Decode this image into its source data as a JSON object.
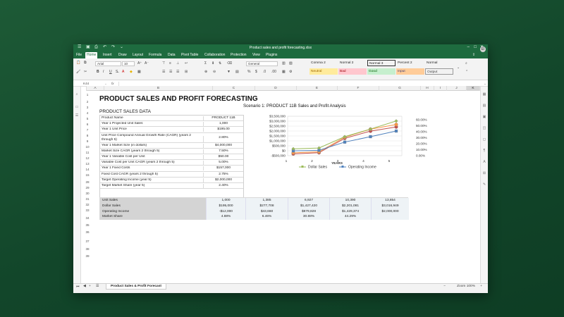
{
  "window": {
    "title": "Product sales and profit forecasting.xlsx",
    "avatar": "EI"
  },
  "menu_tabs": [
    "File",
    "Home",
    "Insert",
    "Draw",
    "Layout",
    "Formula",
    "Data",
    "Pivot Table",
    "Collaboration",
    "Protection",
    "View",
    "Plugins"
  ],
  "ribbon": {
    "font_name": "Arial",
    "font_size": "10",
    "number_format": "General",
    "styles": [
      {
        "label": "Comma 2",
        "bg": "#ffffff",
        "color": "#222222"
      },
      {
        "label": "Normal 2",
        "bg": "#ffffff",
        "color": "#222222"
      },
      {
        "label": "Normal 3",
        "bg": "#ffffff",
        "color": "#222222"
      },
      {
        "label": "Percent 2",
        "bg": "#ffffff",
        "color": "#222222"
      },
      {
        "label": "Normal",
        "bg": "#ffffff",
        "color": "#222222"
      },
      {
        "label": "Neutral",
        "bg": "#ffeb9c",
        "color": "#9c6500"
      },
      {
        "label": "Bad",
        "bg": "#ffc7ce",
        "color": "#9c0006"
      },
      {
        "label": "Good",
        "bg": "#c6efce",
        "color": "#006100"
      },
      {
        "label": "Input",
        "bg": "#ffcc99",
        "color": "#3f3f76"
      },
      {
        "label": "Output",
        "bg": "#f2f2f2",
        "color": "#3f3f3f"
      }
    ]
  },
  "formula_bar": {
    "name_box": "K44",
    "fx": "fx"
  },
  "columns": [
    "A",
    "B",
    "C",
    "D",
    "E",
    "F",
    "G",
    "H",
    "I",
    "J",
    "K"
  ],
  "rows": [
    "1",
    "2",
    "3",
    "4",
    "5",
    "6",
    "7",
    "8",
    "9",
    "10",
    "11",
    "12",
    "13",
    "14",
    "15",
    "28",
    "29",
    "30",
    "31",
    "32",
    "33",
    "34",
    "35",
    "36",
    "37",
    "38",
    "39"
  ],
  "sheet": {
    "title": "PRODUCT SALES AND PROFIT FORECASTING",
    "section_title": "PRODUCT SALES DATA",
    "inputs": [
      {
        "label": "Product Name",
        "value": "PRODUCT 11B"
      },
      {
        "label": "Year 1 Projected Unit Sales",
        "value": "1,000"
      },
      {
        "label": "Year 1 Unit Price",
        "value": "$195.00"
      },
      {
        "label": "Unit Price Compound Annual Growth Rate (CAGR) (years 2 through 5)",
        "value": "2.80%"
      },
      {
        "label": "Year 1 Market Size (in dollars)",
        "value": "$4,000,000"
      },
      {
        "label": "Market Size CAGR (years 2 through 5)",
        "value": "7.50%"
      },
      {
        "label": "Year 1 Variable Cost per Unit",
        "value": "$50.00"
      },
      {
        "label": "Variable Cost per Unit CAGR (years 2 through 5)",
        "value": "5.00%"
      },
      {
        "label": "Year 1 Fixed Costs",
        "value": "$157,000"
      },
      {
        "label": "Fixed Cost CAGR (years 2 through 5)",
        "value": "2.75%"
      },
      {
        "label": "Target Operating Income (year 5)",
        "value": "$2,000,000"
      },
      {
        "label": "Target Market Share (year 5)",
        "value": "2.40%"
      }
    ],
    "summary": [
      {
        "label": "Unit Sales",
        "values": [
          "1,000",
          "1,385",
          "6,927",
          "10,390",
          "13,854"
        ]
      },
      {
        "label": "Dollar Sales",
        "values": [
          "$195,000",
          "$277,708",
          "$1,427,420",
          "$2,201,081",
          "$3,016,949"
        ]
      },
      {
        "label": "Operating Income",
        "values": [
          "-$12,000",
          "$43,660",
          "$879,828",
          "$1,429,374",
          "$2,000,000"
        ]
      },
      {
        "label": "Market Share",
        "values": [
          "4.88%",
          "6.46%",
          "30.88%",
          "44.29%",
          ""
        ]
      }
    ]
  },
  "chart_data": {
    "type": "line",
    "title": "Scenario 1: PRODUCT 11B Sales and Profit Analysis",
    "xlabel": "YEARS",
    "x": [
      1,
      2,
      3,
      4,
      5
    ],
    "left_ticks": [
      "$3,500,000",
      "$3,000,000",
      "$2,500,000",
      "$2,000,000",
      "$1,500,000",
      "$1,000,000",
      "$500,000",
      "$0",
      "-$500,000"
    ],
    "right_ticks": [
      "60.00%",
      "50.00%",
      "40.00%",
      "30.00%",
      "20.00%",
      "10.00%",
      "0.00%"
    ],
    "ylim": [
      -500000,
      3500000
    ],
    "y2lim": [
      0,
      60
    ],
    "series": [
      {
        "name": "Dollar Sales",
        "values": [
          195000,
          277708,
          1427420,
          2201081,
          3016949
        ],
        "color": "#9bbb59",
        "axis": "left"
      },
      {
        "name": "Operating Income",
        "values": [
          -12000,
          43660,
          879828,
          1429374,
          2000000
        ],
        "color": "#4f81bd",
        "axis": "left"
      },
      {
        "name": "",
        "values": [
          4.88,
          6.46,
          30.88,
          44.29,
          52
        ],
        "color": "#f79646",
        "axis": "right"
      },
      {
        "name": "",
        "values": [
          3,
          5,
          29,
          41,
          48
        ],
        "color": "#c0504d",
        "axis": "right"
      }
    ]
  },
  "status": {
    "sheet_tab": "Product Sales & Profit Forecast",
    "zoom": "Zoom 100%",
    "add": "+"
  },
  "colors": {
    "accent": "#1e6b3f"
  }
}
